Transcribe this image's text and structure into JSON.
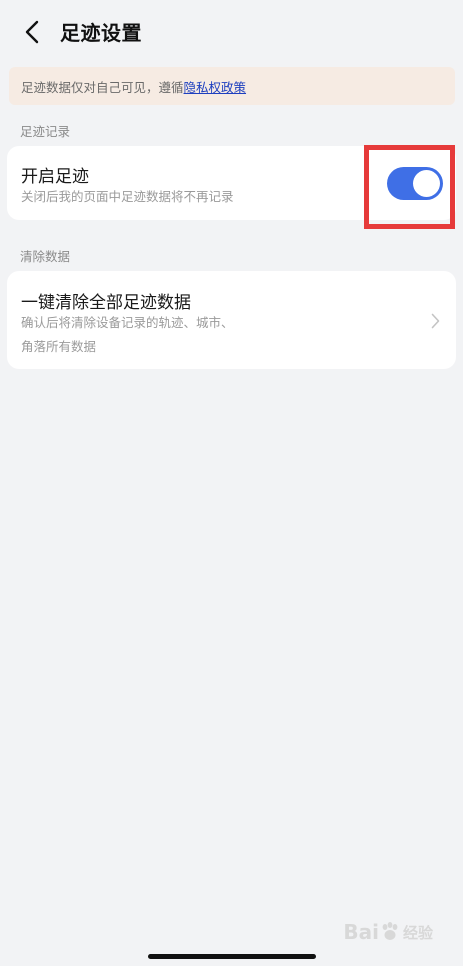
{
  "header": {
    "title": "足迹设置"
  },
  "notice": {
    "text": "足迹数据仅对自己可见，遵循",
    "link_label": "隐私权政策"
  },
  "sections": [
    {
      "label": "足迹记录",
      "item": {
        "title": "开启足迹",
        "description": "关闭后我的页面中足迹数据将不再记录",
        "toggle_on": true
      }
    },
    {
      "label": "清除数据",
      "item": {
        "title": "一键清除全部足迹数据",
        "description_line1": "确认后将清除设备记录的轨迹、城市、",
        "description_line2": "角落所有数据"
      }
    }
  ],
  "colors": {
    "toggle_active": "#3f6fe6",
    "link": "#1d3fbf",
    "highlight": "#e63a3a",
    "notice_bg": "#f6ebe3",
    "page_bg": "#f2f3f5"
  },
  "watermark": {
    "brand": "Bai",
    "suffix": "经验"
  }
}
